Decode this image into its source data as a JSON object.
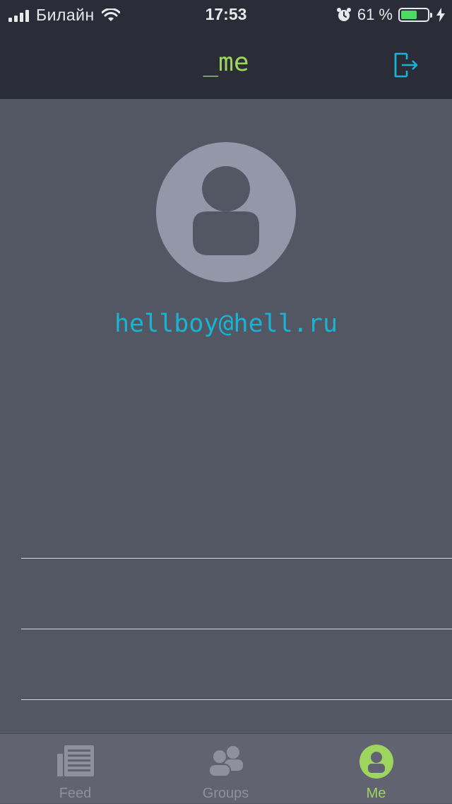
{
  "status_bar": {
    "carrier": "Билайн",
    "time": "17:53",
    "battery_percent": "61 %",
    "battery_level": 0.61,
    "icons": [
      "signal-icon",
      "wifi-icon",
      "alarm-icon",
      "battery-icon",
      "charging-icon"
    ]
  },
  "nav": {
    "title": "_me",
    "logout_icon": "logout-icon"
  },
  "profile": {
    "avatar_icon": "user-placeholder-icon",
    "email": "hellboy@hell.ru"
  },
  "tabs": [
    {
      "label": "Feed",
      "icon": "feed-icon",
      "selected": false
    },
    {
      "label": "Groups",
      "icon": "groups-icon",
      "selected": false
    },
    {
      "label": "Me",
      "icon": "me-icon",
      "selected": true
    }
  ],
  "colors": {
    "accent_green": "#9ed55f",
    "accent_cyan": "#19b3d3",
    "nav_bg": "#2a2d37",
    "content_bg": "#525763",
    "tab_bar_bg": "#616470",
    "tab_inactive": "#8e919b"
  }
}
